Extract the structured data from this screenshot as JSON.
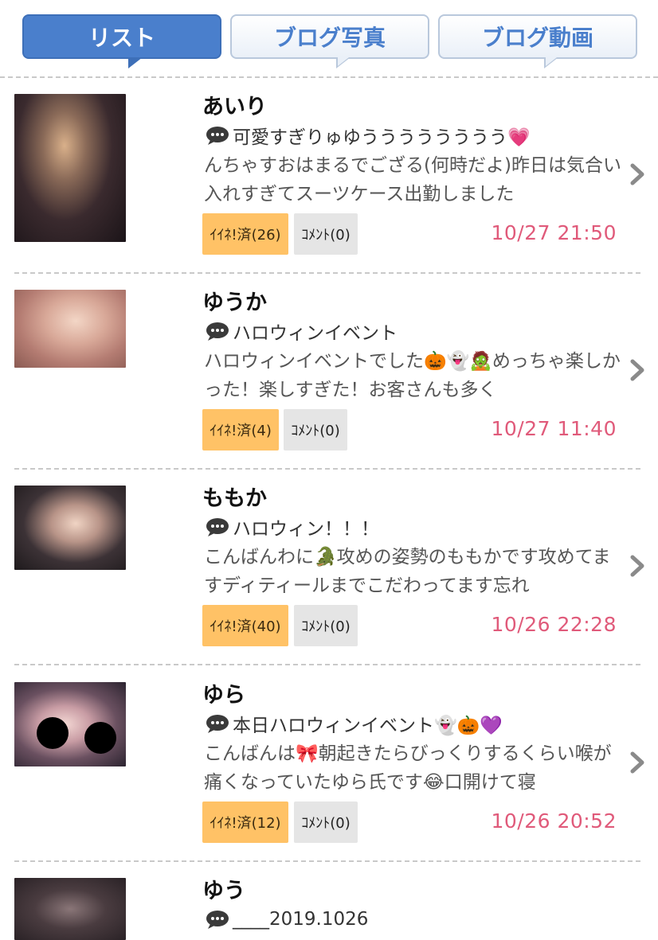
{
  "tabs": [
    {
      "label": "リスト",
      "active": true
    },
    {
      "label": "ブログ写真",
      "active": false
    },
    {
      "label": "ブログ動画",
      "active": false
    }
  ],
  "colors": {
    "accent": "#4a7fcc",
    "like_button": "#ffc266",
    "comment_button": "#e5e5e5",
    "date": "#e05a7a"
  },
  "posts": [
    {
      "name": "あいり",
      "title": "可愛すぎりゅゆうううううううう💗",
      "excerpt": "んちゃすおはまるでござる(何時だよ)昨日は気合い入れすぎてスーツケース出勤しました",
      "like_label": "ｲｲﾈ!済(26)",
      "comment_label": "ｺﾒﾝﾄ(0)",
      "date": "10/27 21:50"
    },
    {
      "name": "ゆうか",
      "title": "ハロウィンイベント",
      "excerpt": "ハロウィンイベントでした🎃👻🧟めっちゃ楽しかった！楽しすぎた！お客さんも多く",
      "like_label": "ｲｲﾈ!済(4)",
      "comment_label": "ｺﾒﾝﾄ(0)",
      "date": "10/27 11:40"
    },
    {
      "name": "ももか",
      "title": "ハロウィン！！！",
      "excerpt": "こんばんわに🐊攻めの姿勢のももかです攻めてますディティールまでこだわってます忘れ",
      "like_label": "ｲｲﾈ!済(40)",
      "comment_label": "ｺﾒﾝﾄ(0)",
      "date": "10/26 22:28"
    },
    {
      "name": "ゆら",
      "title": "本日ハロウィンイベント👻🎃💜",
      "excerpt": "こんばんは🎀朝起きたらびっくりするくらい喉が痛くなっていたゆら氏です😂口開けて寝",
      "like_label": "ｲｲﾈ!済(12)",
      "comment_label": "ｺﾒﾝﾄ(0)",
      "date": "10/26 20:52"
    },
    {
      "name": "ゆう",
      "title": "____2019.1026",
      "excerpt": "",
      "like_label": "",
      "comment_label": "",
      "date": ""
    }
  ]
}
